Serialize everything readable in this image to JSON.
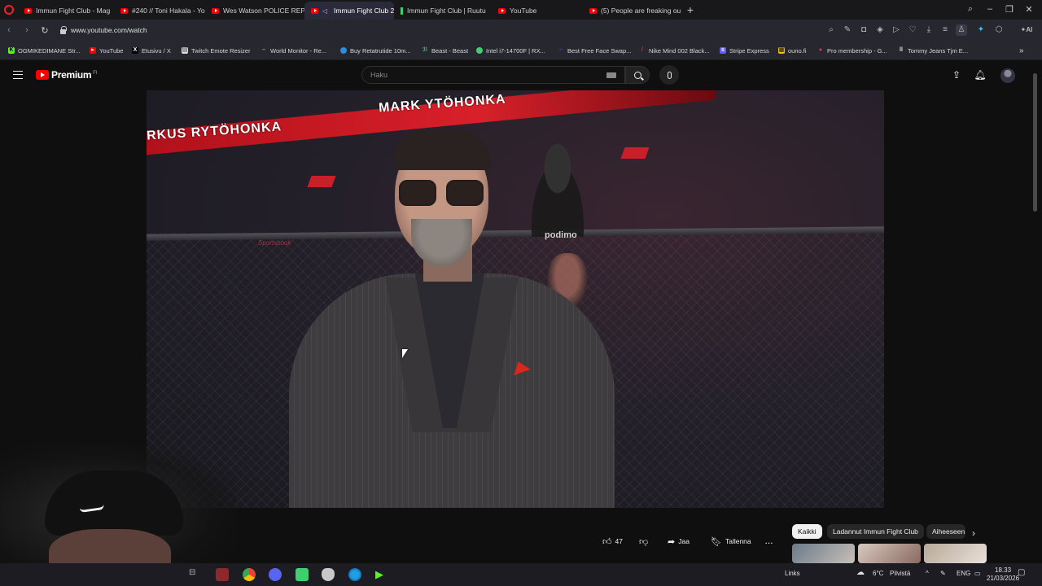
{
  "browser": {
    "tabs": [
      {
        "title": "Immun Fight Club - Mag",
        "icon": "youtube"
      },
      {
        "title": "#240 // Toni Hakala - You",
        "icon": "youtube"
      },
      {
        "title": "Wes Watson POLICE REPO",
        "icon": "youtube"
      },
      {
        "title": "Immun Fight Club 21",
        "icon": "youtube-playing",
        "active": true
      },
      {
        "title": "Immun Fight Club | Ruutu",
        "icon": "ruutu"
      },
      {
        "title": "YouTube",
        "icon": "youtube"
      },
      {
        "title": "(5) People are freaking ou",
        "icon": "youtube"
      }
    ],
    "url": "www.youtube.com/watch",
    "bookmarks": [
      {
        "label": "OGMIKEDIMANE Str...",
        "icon": "kick",
        "color": "#53fc18"
      },
      {
        "label": "YouTube",
        "icon": "youtube",
        "color": "#ff0000"
      },
      {
        "label": "Etusivu / X",
        "icon": "x",
        "color": "#000000"
      },
      {
        "label": "Twitch Emote Resizer",
        "icon": "page",
        "color": "#dddddd"
      },
      {
        "label": "World Monitor - Re...",
        "icon": "dash",
        "color": "#888888"
      },
      {
        "label": "Buy Retatrutide 10m...",
        "icon": "globe",
        "color": "#2a8ee0"
      },
      {
        "label": "Beast - Beast",
        "icon": "beast",
        "color": "#3ecf6e"
      },
      {
        "label": "Intel i7-14700F | RX...",
        "icon": "circle",
        "color": "#3ecf6e"
      },
      {
        "label": "Best Free Face Swap...",
        "icon": "dash",
        "color": "#4455cc"
      },
      {
        "label": "Nike Mind 002 Black...",
        "icon": "pen",
        "color": "#cc3333"
      },
      {
        "label": "Stripe Express",
        "icon": "stripe",
        "color": "#635bff"
      },
      {
        "label": "ouno.fi",
        "icon": "grid",
        "color": "#e8c020"
      },
      {
        "label": "Pro membership - G...",
        "icon": "pin",
        "color": "#e03a3a"
      },
      {
        "label": "Tommy Jeans Tjm E...",
        "icon": "bars",
        "color": "#eeeeee"
      }
    ]
  },
  "youtube": {
    "brand": "Premium",
    "country": "FI",
    "search_placeholder": "Haku"
  },
  "video": {
    "banner_text_1": "RKUS RYTÖHONKA",
    "banner_text_2": "MARK    YTÖHONKA",
    "sponsor": "podimo",
    "rail_text": "Sportsbook"
  },
  "actions": {
    "likes": "47",
    "share": "Jaa",
    "save": "Tallenna",
    "more": "..."
  },
  "chips": [
    "Kaikki",
    "Ladannut Immun Fight Club",
    "Aiheeseen"
  ],
  "taskbar": {
    "links_label": "Links",
    "weather_temp": "6°C",
    "weather_text": "Pilvistä",
    "lang": "ENG",
    "time": "18.33",
    "date": "21/03/2026"
  },
  "colors": {
    "accent_red": "#ff0000",
    "chip_active_bg": "#f1f1f1",
    "page_bg": "#0f0f0f"
  }
}
